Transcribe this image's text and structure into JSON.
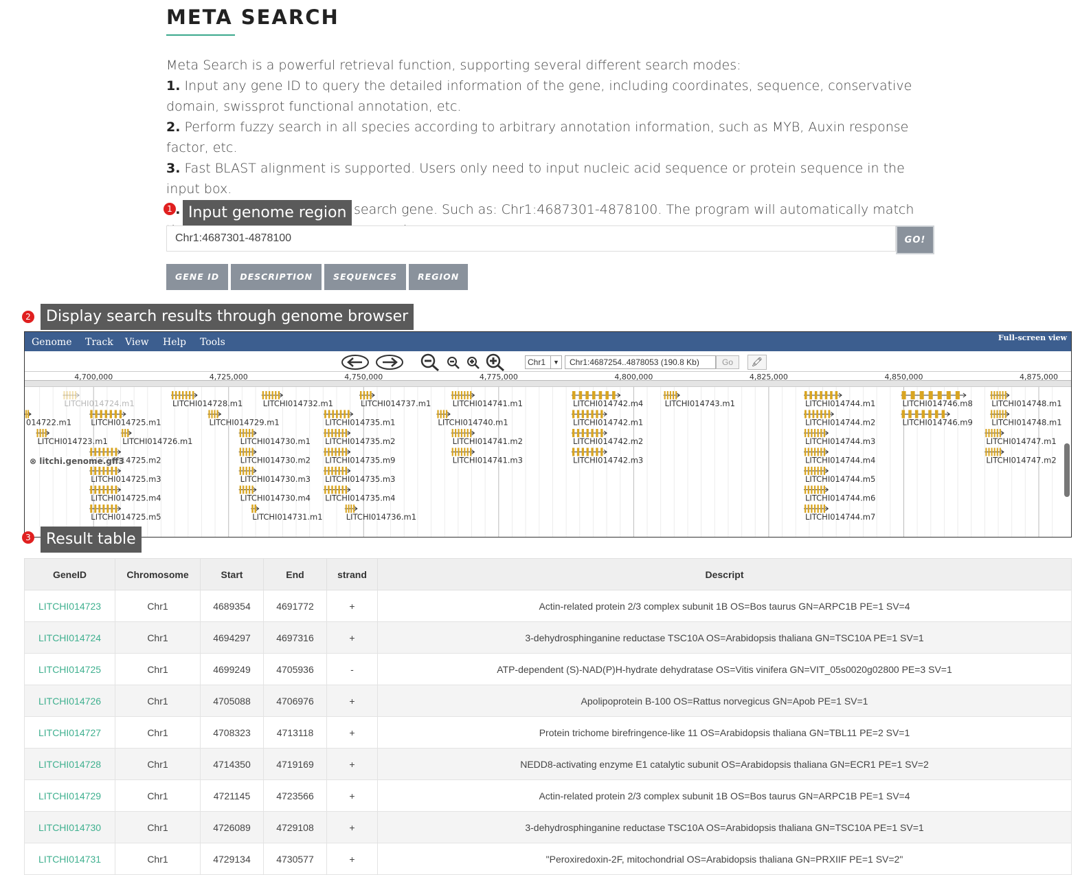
{
  "header": {
    "title": "META SEARCH"
  },
  "intro": {
    "lead": "Meta Search is a powerful retrieval function, supporting several different search modes:",
    "items": [
      {
        "num": "1.",
        "text": " Input any gene ID to query the detailed information of the gene, including coordinates, sequence, conservative domain, swissprot functional annotation, etc."
      },
      {
        "num": "2.",
        "text": " Perform fuzzy search in all species according to arbitrary annotation information, such as MYB, Auxin response factor, etc."
      },
      {
        "num": "3.",
        "text": " Fast BLAST alignment is supported. Users only need to input nucleic acid sequence or protein sequence in the input box."
      },
      {
        "num": "4.",
        "text": " Input a genome region to search gene. Such as: Chr1:4687301-4878100. The program will automatically match the corresponding genome for search."
      }
    ]
  },
  "callouts": [
    {
      "num": "1",
      "text": "Input genome region"
    },
    {
      "num": "2",
      "text": "Display search results through genome browser"
    },
    {
      "num": "3",
      "text": "Result table"
    }
  ],
  "search": {
    "value": "Chr1:4687301-4878100",
    "go_label": "GO!"
  },
  "modes": [
    "GENE ID",
    "DESCRIPTION",
    "SEQUENCES",
    "REGION"
  ],
  "browser": {
    "menu": [
      "Genome",
      "Track",
      "View",
      "Help",
      "Tools"
    ],
    "fullscreen": "Full-screen view",
    "chrom": "Chr1",
    "location": "Chr1:4687254..4878053 (190.8 Kb)",
    "go_label": "Go",
    "track_name": "litchi.genome.gff3",
    "ticks": [
      "4,700,000",
      "4,725,000",
      "4,750,000",
      "4,775,000",
      "4,800,000",
      "4,825,000",
      "4,850,000",
      "4,875,000"
    ],
    "features": [
      {
        "label": "LITCHI014724.m1",
        "start": 4694297,
        "end": 4697316,
        "row": 0,
        "faded": true
      },
      {
        "label": "LITCHI014728.m1",
        "start": 4714350,
        "end": 4719169,
        "row": 0
      },
      {
        "label": "LITCHI014732.m1",
        "start": 4731100,
        "end": 4735000,
        "row": 0
      },
      {
        "label": "LITCHI014737.m1",
        "start": 4749200,
        "end": 4752000,
        "row": 0
      },
      {
        "label": "LITCHI014741.m1",
        "start": 4766200,
        "end": 4770500,
        "row": 0
      },
      {
        "label": "LITCHI014742.m4",
        "start": 4788500,
        "end": 4797500,
        "row": 0
      },
      {
        "label": "LITCHI014743.m1",
        "start": 4805500,
        "end": 4808500,
        "row": 0
      },
      {
        "label": "LITCHI014744.m1",
        "start": 4831500,
        "end": 4838500,
        "row": 0
      },
      {
        "label": "LITCHI014746.m8",
        "start": 4849500,
        "end": 4861500,
        "row": 0
      },
      {
        "label": "LITCHI014748.m1",
        "start": 4866000,
        "end": 4869500,
        "row": 0
      },
      {
        "label": "014722.m1",
        "start": 4687254,
        "end": 4688400,
        "row": 1
      },
      {
        "label": "LITCHI014725.m1",
        "start": 4699249,
        "end": 4705936,
        "row": 1
      },
      {
        "label": "LITCHI014729.m1",
        "start": 4721145,
        "end": 4723566,
        "row": 1
      },
      {
        "label": "LITCHI014735.m1",
        "start": 4742600,
        "end": 4748000,
        "row": 1
      },
      {
        "label": "LITCHI014740.m1",
        "start": 4763500,
        "end": 4766000,
        "row": 1
      },
      {
        "label": "LITCHI014742.m1",
        "start": 4788500,
        "end": 4795000,
        "row": 1
      },
      {
        "label": "LITCHI014744.m2",
        "start": 4831500,
        "end": 4837000,
        "row": 1
      },
      {
        "label": "LITCHI014746.m9",
        "start": 4849500,
        "end": 4858500,
        "row": 1
      },
      {
        "label": "LITCHI014748.m1",
        "start": 4866000,
        "end": 4869500,
        "row": 1
      },
      {
        "label": "LITCHI014723.m1",
        "start": 4689354,
        "end": 4691772,
        "row": 2
      },
      {
        "label": "LITCHI014726.m1",
        "start": 4705088,
        "end": 4706976,
        "row": 2
      },
      {
        "label": "LITCHI014730.m1",
        "start": 4726900,
        "end": 4730100,
        "row": 2
      },
      {
        "label": "LITCHI014735.m2",
        "start": 4742600,
        "end": 4747500,
        "row": 2
      },
      {
        "label": "LITCHI014741.m2",
        "start": 4766200,
        "end": 4770500,
        "row": 2
      },
      {
        "label": "LITCHI014742.m2",
        "start": 4788500,
        "end": 4795000,
        "row": 2
      },
      {
        "label": "LITCHI014744.m3",
        "start": 4831500,
        "end": 4836000,
        "row": 2
      },
      {
        "label": "LITCHI014747.m1",
        "start": 4865000,
        "end": 4868500,
        "row": 2
      },
      {
        "label": "LITCHI014725.m2",
        "start": 4699249,
        "end": 4705000,
        "row": 3
      },
      {
        "label": "LITCHI014730.m2",
        "start": 4726900,
        "end": 4730100,
        "row": 3
      },
      {
        "label": "LITCHI014735.m9",
        "start": 4742600,
        "end": 4747500,
        "row": 3
      },
      {
        "label": "LITCHI014741.m3",
        "start": 4766200,
        "end": 4770500,
        "row": 3
      },
      {
        "label": "LITCHI014742.m3",
        "start": 4788500,
        "end": 4795000,
        "row": 3
      },
      {
        "label": "LITCHI014744.m4",
        "start": 4831500,
        "end": 4836000,
        "row": 3
      },
      {
        "label": "LITCHI014747.m2",
        "start": 4865000,
        "end": 4868500,
        "row": 3
      },
      {
        "label": "LITCHI014725.m3",
        "start": 4699249,
        "end": 4705000,
        "row": 4
      },
      {
        "label": "LITCHI014730.m3",
        "start": 4726900,
        "end": 4730100,
        "row": 4
      },
      {
        "label": "LITCHI014735.m3",
        "start": 4742600,
        "end": 4747500,
        "row": 4
      },
      {
        "label": "LITCHI014744.m5",
        "start": 4831500,
        "end": 4836000,
        "row": 4
      },
      {
        "label": "LITCHI014725.m4",
        "start": 4699249,
        "end": 4705000,
        "row": 5
      },
      {
        "label": "LITCHI014730.m4",
        "start": 4726900,
        "end": 4730100,
        "row": 5
      },
      {
        "label": "LITCHI014735.m4",
        "start": 4742600,
        "end": 4747500,
        "row": 5
      },
      {
        "label": "LITCHI014744.m6",
        "start": 4831500,
        "end": 4836000,
        "row": 5
      },
      {
        "label": "LITCHI014725.m5",
        "start": 4699249,
        "end": 4705000,
        "row": 6
      },
      {
        "label": "LITCHI014731.m1",
        "start": 4729134,
        "end": 4730577,
        "row": 6
      },
      {
        "label": "LITCHI014736.m1",
        "start": 4746500,
        "end": 4748800,
        "row": 6
      },
      {
        "label": "LITCHI014744.m7",
        "start": 4831500,
        "end": 4836000,
        "row": 6
      }
    ]
  },
  "table": {
    "columns": [
      "GeneID",
      "Chromosome",
      "Start",
      "End",
      "strand",
      "Descript"
    ],
    "rows": [
      [
        "LITCHI014723",
        "Chr1",
        "4689354",
        "4691772",
        "+",
        "Actin-related protein 2/3 complex subunit 1B OS=Bos taurus GN=ARPC1B PE=1 SV=4"
      ],
      [
        "LITCHI014724",
        "Chr1",
        "4694297",
        "4697316",
        "+",
        "3-dehydrosphinganine reductase TSC10A OS=Arabidopsis thaliana GN=TSC10A PE=1 SV=1"
      ],
      [
        "LITCHI014725",
        "Chr1",
        "4699249",
        "4705936",
        "-",
        "ATP-dependent (S)-NAD(P)H-hydrate dehydratase OS=Vitis vinifera GN=VIT_05s0020g02800 PE=3 SV=1"
      ],
      [
        "LITCHI014726",
        "Chr1",
        "4705088",
        "4706976",
        "+",
        "Apolipoprotein B-100 OS=Rattus norvegicus GN=Apob PE=1 SV=1"
      ],
      [
        "LITCHI014727",
        "Chr1",
        "4708323",
        "4713118",
        "+",
        "Protein trichome birefringence-like 11 OS=Arabidopsis thaliana GN=TBL11 PE=2 SV=1"
      ],
      [
        "LITCHI014728",
        "Chr1",
        "4714350",
        "4719169",
        "+",
        "NEDD8-activating enzyme E1 catalytic subunit OS=Arabidopsis thaliana GN=ECR1 PE=1 SV=2"
      ],
      [
        "LITCHI014729",
        "Chr1",
        "4721145",
        "4723566",
        "+",
        "Actin-related protein 2/3 complex subunit 1B OS=Bos taurus GN=ARPC1B PE=1 SV=4"
      ],
      [
        "LITCHI014730",
        "Chr1",
        "4726089",
        "4729108",
        "+",
        "3-dehydrosphinganine reductase TSC10A OS=Arabidopsis thaliana GN=TSC10A PE=1 SV=1"
      ],
      [
        "LITCHI014731",
        "Chr1",
        "4729134",
        "4730577",
        "+",
        "\"Peroxiredoxin-2F, mitochondrial OS=Arabidopsis thaliana GN=PRXIIF PE=1 SV=2\""
      ]
    ]
  }
}
